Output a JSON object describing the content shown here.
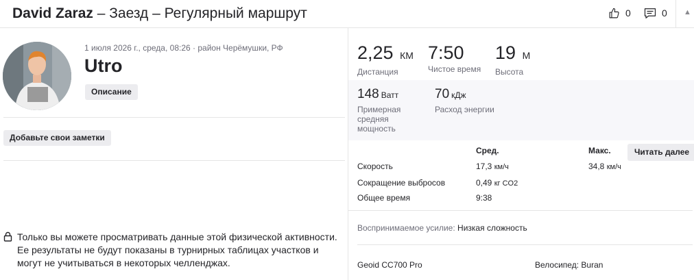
{
  "header": {
    "athlete": "David Zaraz",
    "title_rest": " – Заезд – Регулярный маршрут",
    "kudos_count": "0",
    "comments_count": "0"
  },
  "left": {
    "meta": "1 июля 2026 г., среда, 08:26 · район Черёмушки, РФ",
    "activity_name": "Utro",
    "description_button": "Описание",
    "notes_button": "Добавьте свои заметки",
    "privacy_text": "Только вы можете просматривать данные этой физической активности. Ее результаты не будут показаны в турнирных таблицах участков и могут не учитываться в некоторых челленджах."
  },
  "stats": {
    "distance": {
      "value": "2,25",
      "unit": "КМ",
      "label": "Дистанция"
    },
    "moving_time": {
      "value": "7:50",
      "label": "Чистое время"
    },
    "elevation": {
      "value": "19",
      "unit": "М",
      "label": "Высота"
    },
    "power": {
      "value": "148",
      "unit": "Ватт",
      "label": "Примерная средняя мощность"
    },
    "energy": {
      "value": "70",
      "unit": "кДж",
      "label": "Расход энергии"
    }
  },
  "table": {
    "col_avg": "Сред.",
    "col_max": "Макс.",
    "read_more": "Читать далее",
    "rows": [
      {
        "label": "Скорость",
        "avg_value": "17,3",
        "avg_unit": "км/ч",
        "max_value": "34,8",
        "max_unit": "км/ч"
      },
      {
        "label": "Сокращение выбросов",
        "avg_value": "0,49",
        "avg_unit": "кг CO2"
      },
      {
        "label": "Общее время",
        "avg_value": "9:38"
      }
    ]
  },
  "effort": {
    "label": "Воспринимаемое усилие:",
    "value": "Низкая сложность"
  },
  "gear": {
    "device": "Geoid CC700 Pro",
    "bike_label": "Велосипед:",
    "bike_value": "Buran"
  }
}
